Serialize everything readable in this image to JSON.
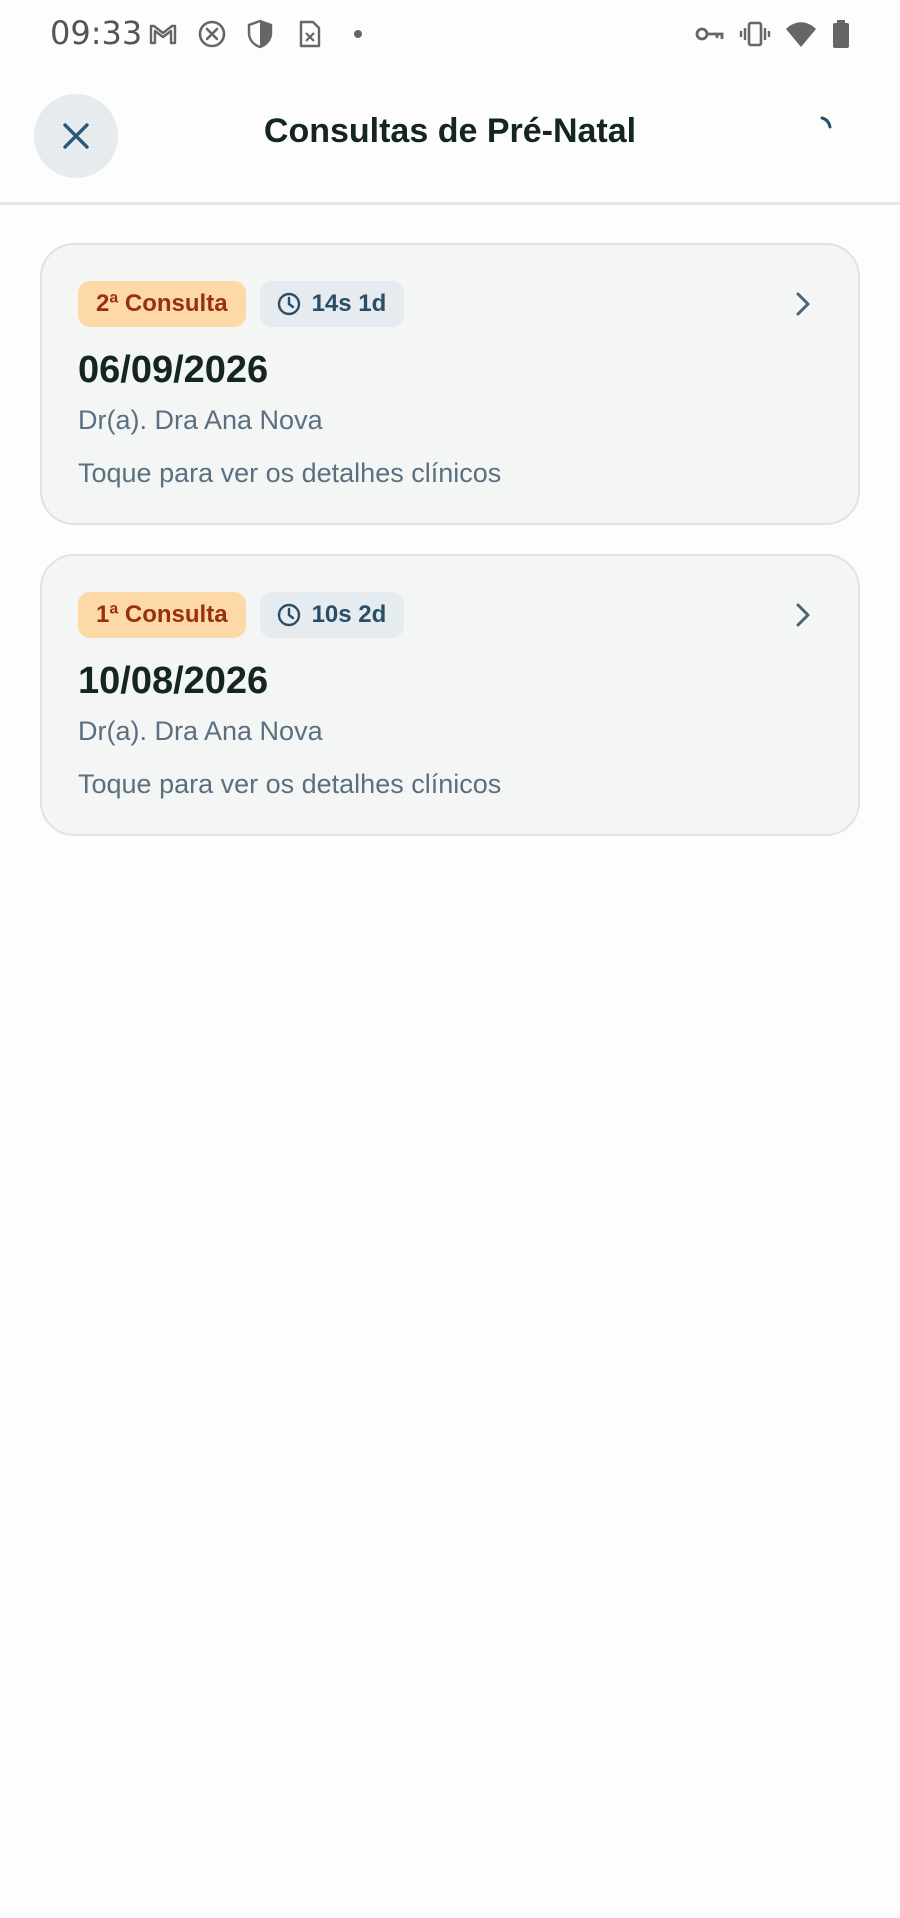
{
  "status_bar": {
    "time": "09:33",
    "left_icons": [
      "gmail-icon",
      "cancel-circle-icon",
      "shield-icon",
      "sim-card-icon",
      "notification-dot-icon"
    ],
    "right_icons": [
      "vpn-key-icon",
      "vibrate-icon",
      "wifi-icon",
      "battery-icon"
    ]
  },
  "header": {
    "title": "Consultas de Pré-Natal",
    "close_icon": "close-icon",
    "loading": true
  },
  "consultations": [
    {
      "label": "2ª Consulta",
      "gestational_age": "14s 1d",
      "date": "06/09/2026",
      "doctor": "Dr(a). Dra Ana Nova",
      "hint": "Toque para ver os detalhes clínicos"
    },
    {
      "label": "1ª Consulta",
      "gestational_age": "10s 2d",
      "date": "10/08/2026",
      "doctor": "Dr(a). Dra Ana Nova",
      "hint": "Toque para ver os detalhes clínicos"
    }
  ],
  "colors": {
    "consult_badge_bg": "#fdd9a8",
    "consult_badge_text": "#9a2f0e",
    "ga_badge_bg": "#e5ebef",
    "ga_badge_text": "#2a4d68",
    "card_bg": "#f4f6f5",
    "accent": "#2a4d68"
  }
}
